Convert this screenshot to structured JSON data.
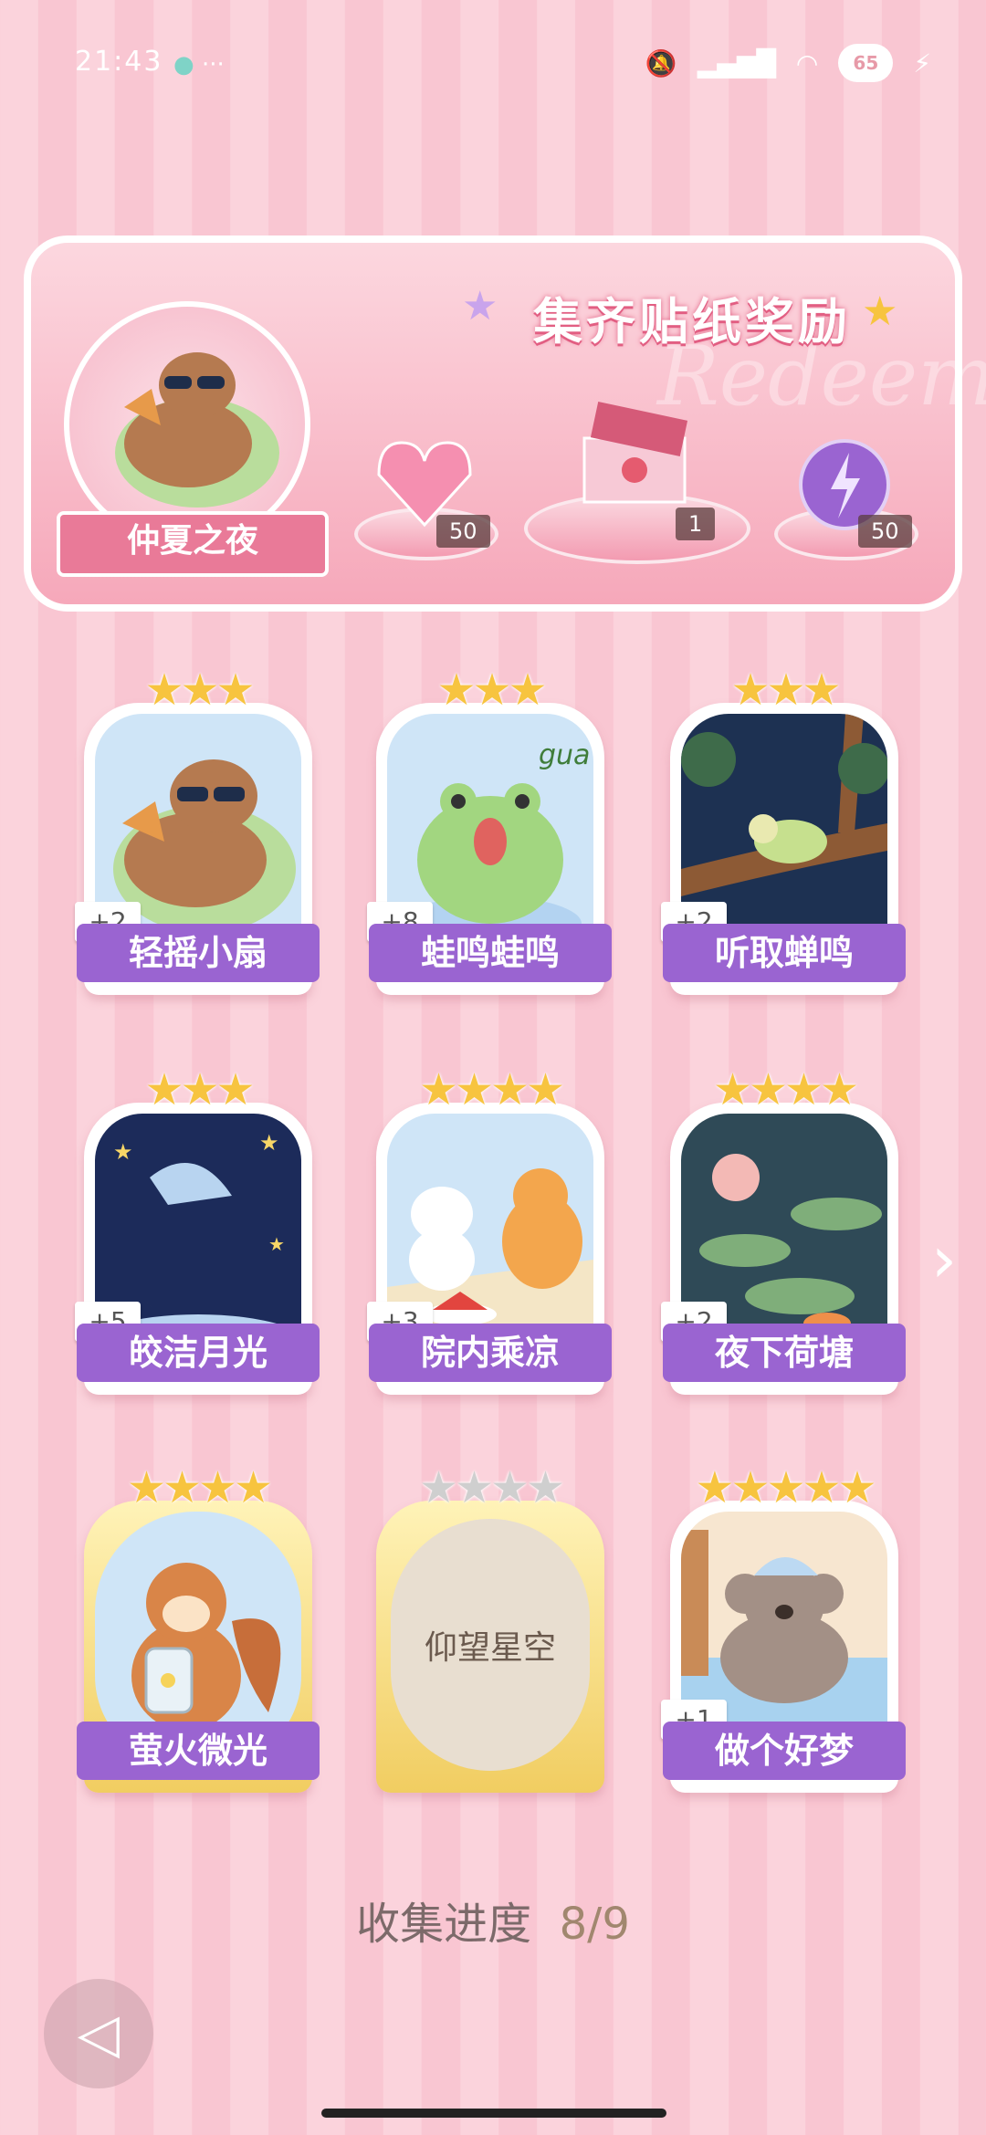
{
  "status_bar": {
    "time": "21:43",
    "extra": "···",
    "battery": "65"
  },
  "banner": {
    "title": "集齐贴纸奖励",
    "watermark": "Redeem",
    "album_name": "仲夏之夜",
    "rewards": [
      {
        "icon": "pink-gem-icon",
        "count": "50"
      },
      {
        "icon": "gift-box-icon",
        "count": "1"
      },
      {
        "icon": "energy-orb-icon",
        "count": "50"
      }
    ]
  },
  "stickers": [
    {
      "name": "轻摇小扇",
      "stars": "★★★",
      "bonus": "+2"
    },
    {
      "name": "蛙鸣蛙鸣",
      "stars": "★★★",
      "bonus": "+8"
    },
    {
      "name": "听取蝉鸣",
      "stars": "★★★",
      "bonus": "+2"
    },
    {
      "name": "皎洁月光",
      "stars": "★★★",
      "bonus": "+5"
    },
    {
      "name": "院内乘凉",
      "stars": "★★★★",
      "bonus": "+3"
    },
    {
      "name": "夜下荷塘",
      "stars": "★★★★",
      "bonus": "+2"
    },
    {
      "name": "萤火微光",
      "stars": "★★★★",
      "bonus": ""
    },
    {
      "name": "仰望星空",
      "stars": "★★★★",
      "locked": true
    },
    {
      "name": "做个好梦",
      "stars": "★★★★★",
      "bonus": "+1"
    }
  ],
  "progress": {
    "label": "收集进度",
    "value": "8/9"
  },
  "frog_text": "gua"
}
